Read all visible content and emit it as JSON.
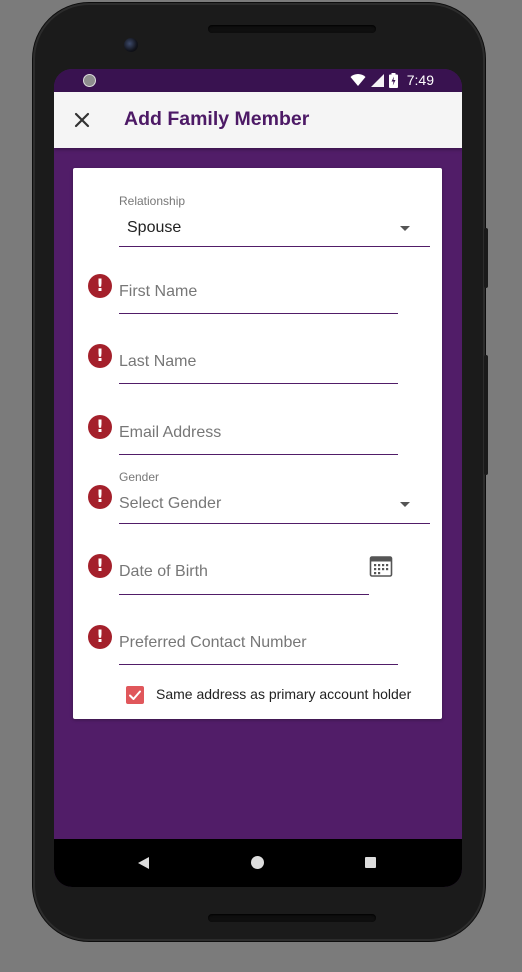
{
  "statusbar": {
    "time": "7:49",
    "icons": [
      "wifi-icon",
      "signal-icon",
      "battery-icon"
    ]
  },
  "appbar": {
    "close_icon": "close-icon",
    "title": "Add Family Member"
  },
  "form": {
    "relationship": {
      "label": "Relationship",
      "value": "Spouse"
    },
    "first_name": {
      "placeholder": "First Name",
      "error": true
    },
    "last_name": {
      "placeholder": "Last Name",
      "error": true
    },
    "email": {
      "placeholder": "Email Address",
      "error": true
    },
    "gender": {
      "label": "Gender",
      "value": "Select Gender",
      "error": true
    },
    "dob": {
      "placeholder": "Date of Birth",
      "error": true,
      "icon": "calendar-icon"
    },
    "contact": {
      "placeholder": "Preferred Contact Number",
      "error": true
    },
    "same_address": {
      "label": "Same address as primary account holder",
      "checked": true
    }
  },
  "colors": {
    "brand": "#511d68",
    "title": "#4d1a66",
    "error": "#a4202b",
    "checkbox": "#e0575b"
  },
  "navbar": {
    "icons": [
      "back-icon",
      "home-icon",
      "recents-icon"
    ]
  }
}
